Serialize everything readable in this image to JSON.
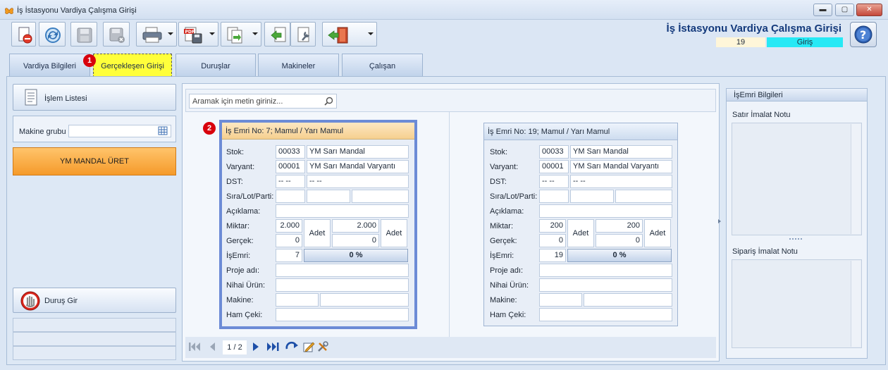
{
  "window": {
    "title": "İş İstasyonu Vardiya Çalışma Girişi",
    "controls": [
      "minimize",
      "maximize",
      "close"
    ]
  },
  "toolbar": {
    "buttons": [
      {
        "name": "new-document",
        "icon": "new-document-red-icon"
      },
      {
        "name": "refresh",
        "icon": "refresh-icon"
      },
      {
        "name": "save",
        "icon": "save-disabled-icon"
      },
      {
        "name": "save-close",
        "icon": "save-close-disabled-icon"
      },
      {
        "name": "print",
        "icon": "printer-icon",
        "dropdown": true
      },
      {
        "name": "export-pdf",
        "icon": "pdf-save-icon",
        "dropdown": true
      },
      {
        "name": "copy-transfer",
        "icon": "document-transfer-icon",
        "dropdown": true
      },
      {
        "name": "import",
        "icon": "import-arrow-icon"
      },
      {
        "name": "document-settings",
        "icon": "document-tools-icon"
      },
      {
        "name": "exit",
        "icon": "exit-door-icon",
        "dropdown": true
      }
    ]
  },
  "header": {
    "title": "İş İstasyonu Vardiya Çalışma Girişi",
    "record_number": "19",
    "mode": "Giriş",
    "mode_color": "#27E9F5"
  },
  "tabs": [
    {
      "label": "Vardiya Bilgileri",
      "active": false
    },
    {
      "label": "Gerçekleşen Girişi",
      "active": true,
      "badge": "1"
    },
    {
      "label": "Duruşlar",
      "active": false
    },
    {
      "label": "Makineler",
      "active": false
    },
    {
      "label": "Çalışan",
      "active": false
    }
  ],
  "left_panel": {
    "operation_list_label": "İşlem Listesi",
    "machine_group_label": "Makine grubu",
    "machine_group_value": "",
    "selected_operation": "YM MANDAL ÜRET",
    "selected_operation_color": "#F79E2C",
    "downtime_button_label": "Duruş Gir"
  },
  "search": {
    "placeholder": "Aramak için metin giriniz..."
  },
  "field_labels": {
    "stock": "Stok:",
    "variant": "Varyant:",
    "dst": "DST:",
    "sequence": "Sıra/Lot/Parti:",
    "description": "Açıklama:",
    "quantity": "Miktar:",
    "actual": "Gerçek:",
    "work_order": "İşEmri:",
    "project": "Proje adı:",
    "final_product": "Nihai Ürün:",
    "machine": "Makine:",
    "raw_draw": "Ham Çeki:"
  },
  "cards": [
    {
      "title": "İş Emri No: 7; Mamul / Yarı Mamul",
      "selected": true,
      "badge": "2",
      "stock_code": "00033",
      "stock_name": "YM Sarı Mandal",
      "variant_code": "00001",
      "variant_name": "YM Sarı Mandal Varyantı",
      "dst_1": "-- --",
      "dst_2": "-- --",
      "quantity_1": "2.000",
      "quantity_2": "2.000",
      "unit_1": "Adet",
      "unit_2": "Adet",
      "actual_1": "0",
      "actual_2": "0",
      "work_order_no": "7",
      "progress": "0 %"
    },
    {
      "title": "İş Emri No: 19; Mamul / Yarı Mamul",
      "selected": false,
      "stock_code": "00033",
      "stock_name": "YM Sarı Mandal",
      "variant_code": "00001",
      "variant_name": "YM Sarı Mandal Varyantı",
      "dst_1": "-- --",
      "dst_2": "-- --",
      "quantity_1": "200",
      "quantity_2": "200",
      "unit_1": "Adet",
      "unit_2": "Adet",
      "actual_1": "0",
      "actual_2": "0",
      "work_order_no": "19",
      "progress": "0 %"
    }
  ],
  "navigator": {
    "page_indicator": "1 / 2",
    "buttons": [
      "first-page-icon",
      "previous-page-icon",
      "next-page-icon",
      "last-page-icon",
      "refresh-arrow-icon",
      "edit-icon",
      "tools-icon"
    ]
  },
  "right_panel": {
    "title": "İşEmri Bilgileri",
    "line_note_label": "Satır İmalat Notu",
    "order_note_label": "Sipariş İmalat Notu"
  },
  "colors": {
    "active_tab": "#FFFF3B",
    "selected_card_border": "#6C8BD6",
    "selected_card_header": "#F8D9A6",
    "badge": "#D8000C"
  }
}
